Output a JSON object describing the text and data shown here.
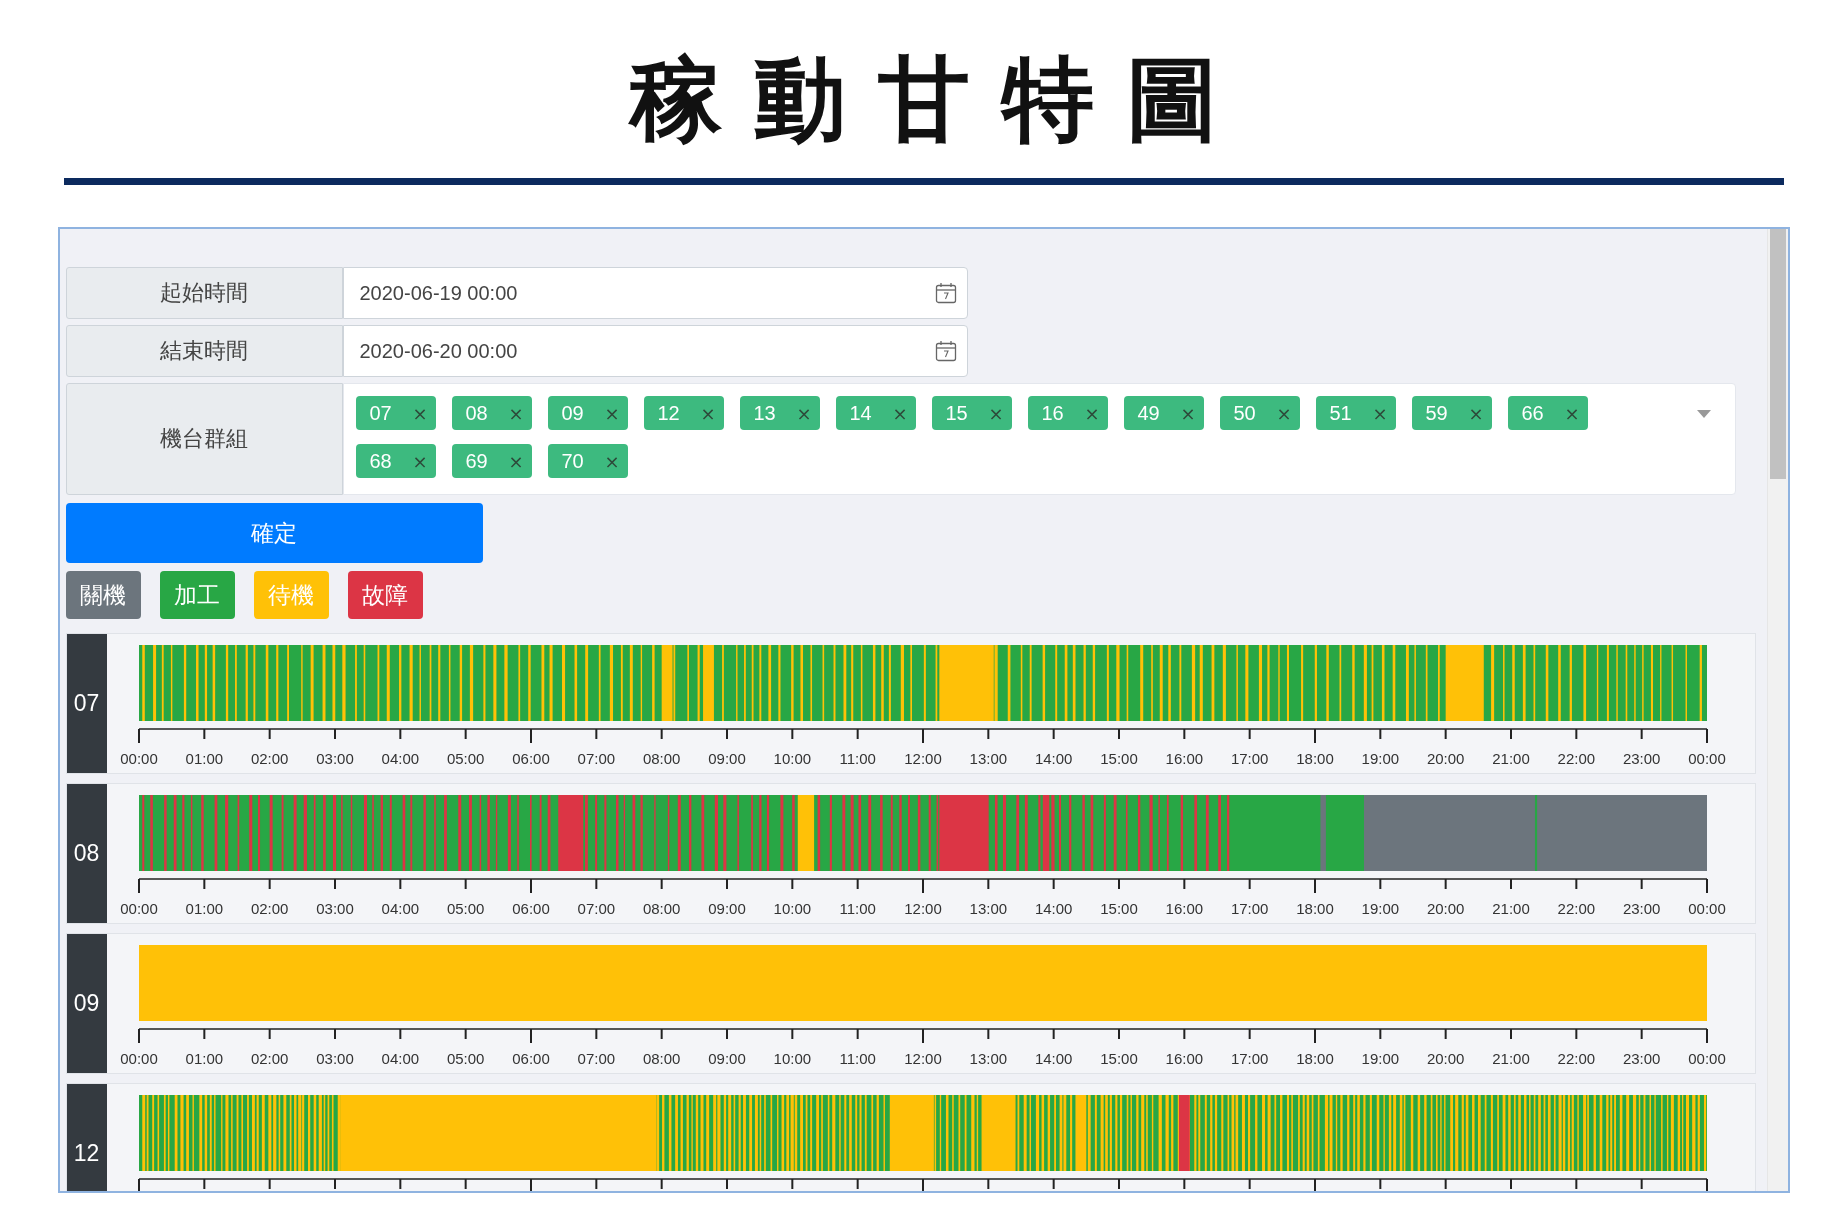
{
  "title": "稼動甘特圖",
  "form": {
    "start": {
      "label": "起始時間",
      "value": "2020-06-19 00:00"
    },
    "end": {
      "label": "結束時間",
      "value": "2020-06-20 00:00"
    },
    "machines": {
      "label": "機台群組",
      "tags": [
        {
          "text": "07",
          "remove": "×"
        },
        {
          "text": "08",
          "remove": "×"
        },
        {
          "text": "09",
          "remove": "×"
        },
        {
          "text": "12",
          "remove": "×"
        },
        {
          "text": "13",
          "remove": "×"
        },
        {
          "text": "14",
          "remove": "×"
        },
        {
          "text": "15",
          "remove": "×"
        },
        {
          "text": "16",
          "remove": "×"
        },
        {
          "text": "49",
          "remove": "×"
        },
        {
          "text": "50",
          "remove": "×"
        },
        {
          "text": "51",
          "remove": "×"
        },
        {
          "text": "59",
          "remove": "×"
        },
        {
          "text": "66",
          "remove": "×"
        },
        {
          "text": "68",
          "remove": "×"
        },
        {
          "text": "69",
          "remove": "×"
        },
        {
          "text": "70",
          "remove": "×"
        }
      ]
    }
  },
  "submit_button": "確定",
  "legend": [
    {
      "label": "關機",
      "color": "#6c757d"
    },
    {
      "label": "加工",
      "color": "#28a745"
    },
    {
      "label": "待機",
      "color": "#ffc107"
    },
    {
      "label": "故障",
      "color": "#dc3545"
    }
  ],
  "rows": [
    {
      "label": "07",
      "kind": "run-idle",
      "ticks": [
        "00:00",
        "01:00",
        "02:00",
        "03:00",
        "04:00",
        "05:00",
        "06:00",
        "07:00",
        "08:00",
        "09:00",
        "10:00",
        "11:00",
        "12:00",
        "13:00",
        "14:00",
        "15:00",
        "16:00",
        "17:00",
        "18:00",
        "19:00",
        "20:00",
        "21:00",
        "22:00",
        "23:00",
        "00:00"
      ]
    },
    {
      "label": "08",
      "kind": "run-fault",
      "ticks": [
        "00:00",
        "01:00",
        "02:00",
        "03:00",
        "04:00",
        "05:00",
        "06:00",
        "07:00",
        "08:00",
        "09:00",
        "10:00",
        "11:00",
        "12:00",
        "13:00",
        "14:00",
        "15:00",
        "16:00",
        "17:00",
        "18:00",
        "19:00",
        "20:00",
        "21:00",
        "22:00",
        "23:00",
        "00:00"
      ]
    },
    {
      "label": "09",
      "kind": "idle",
      "ticks": [
        "00:00",
        "01:00",
        "02:00",
        "03:00",
        "04:00",
        "05:00",
        "06:00",
        "07:00",
        "08:00",
        "09:00",
        "10:00",
        "11:00",
        "12:00",
        "13:00",
        "14:00",
        "15:00",
        "16:00",
        "17:00",
        "18:00",
        "19:00",
        "20:00",
        "21:00",
        "22:00",
        "23:00",
        "00:00"
      ]
    },
    {
      "label": "12",
      "kind": "idle-run"
    }
  ]
}
